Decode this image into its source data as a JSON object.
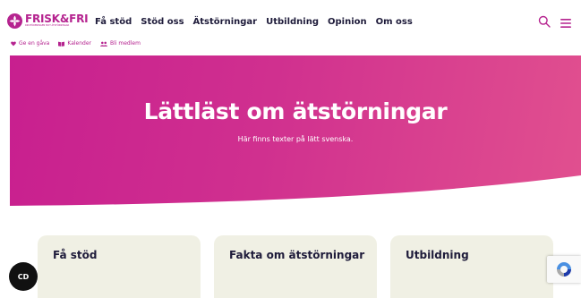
{
  "brand": {
    "name": "FRISK&FRI",
    "tagline": "RIKSFÖRENINGEN MOT ÄTSTÖRNINGAR",
    "accent_color": "#b5238f",
    "text_color": "#1e1b3a"
  },
  "main_nav": [
    {
      "label": "Få stöd"
    },
    {
      "label": "Stöd oss"
    },
    {
      "label": "Ätstörningar"
    },
    {
      "label": "Utbildning"
    },
    {
      "label": "Opinion"
    },
    {
      "label": "Om oss"
    }
  ],
  "header_icons": {
    "search": "search-icon",
    "menu": "hamburger-menu-icon"
  },
  "sub_nav": [
    {
      "label": "Ge en gåva",
      "icon": "heart-icon"
    },
    {
      "label": "Kalender",
      "icon": "calendar-icon"
    },
    {
      "label": "Bli medlem",
      "icon": "members-icon"
    }
  ],
  "hero": {
    "title": "Lättläst om ätstörningar",
    "subtitle": "Här finns texter på lätt svenska.",
    "gradient_start": "#c81f8f",
    "gradient_end": "#e1508f"
  },
  "cards": [
    {
      "title": "Få stöd"
    },
    {
      "title": "Fakta om ätstörningar"
    },
    {
      "title": "Utbildning"
    }
  ],
  "card_color": "#f0f0e4",
  "cookie_button": {
    "label": "CD"
  },
  "recaptcha": {
    "icon": "recaptcha-icon"
  }
}
